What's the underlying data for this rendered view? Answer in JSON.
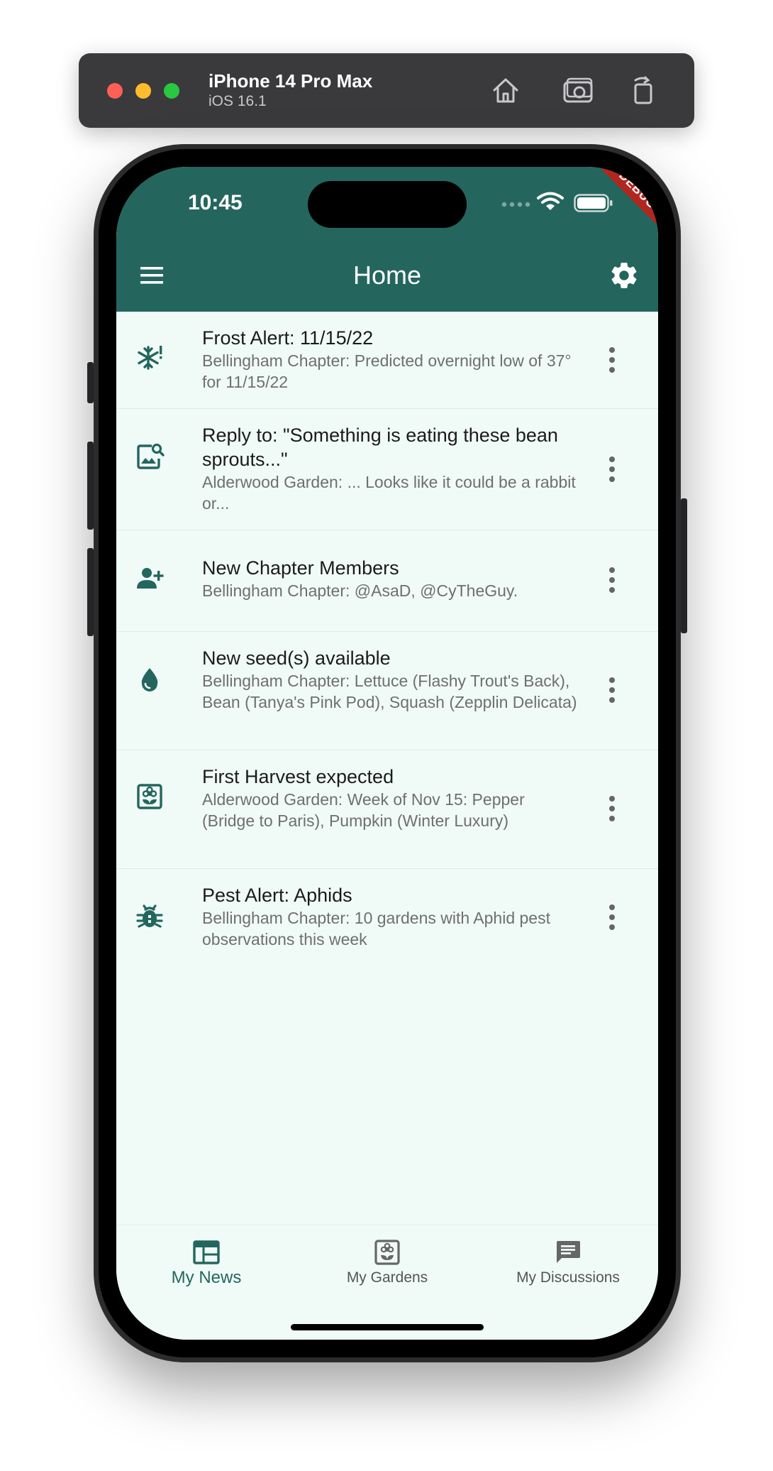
{
  "simulator": {
    "device_name": "iPhone 14 Pro Max",
    "os_version": "iOS 16.1",
    "icons": [
      "home-icon",
      "screenshot-icon",
      "rotate-icon"
    ]
  },
  "status_bar": {
    "time": "10:45"
  },
  "debug_banner": "DEBUG",
  "header": {
    "title": "Home",
    "menu_icon": "menu-icon",
    "settings_icon": "gear-icon"
  },
  "news": [
    {
      "icon": "snowflake-alert-icon",
      "title": "Frost Alert: 11/15/22",
      "subtitle": "Bellingham Chapter: Predicted overnight low of 37° for 11/15/22"
    },
    {
      "icon": "image-search-icon",
      "title": "Reply to: \"Something is eating these bean sprouts...\"",
      "subtitle": "Alderwood Garden: ... Looks like it could be a rabbit or..."
    },
    {
      "icon": "person-add-icon",
      "title": "New Chapter Members",
      "subtitle": "Bellingham Chapter: @AsaD, @CyTheGuy."
    },
    {
      "icon": "water-drop-icon",
      "title": "New seed(s) available",
      "subtitle": "Bellingham Chapter: Lettuce (Flashy Trout's Back), Bean (Tanya's Pink Pod), Squash (Zepplin Delicata)"
    },
    {
      "icon": "local-florist-icon",
      "title": "First Harvest expected",
      "subtitle": "Alderwood Garden: Week of Nov 15: Pepper (Bridge to Paris), Pumpkin (Winter Luxury)"
    },
    {
      "icon": "bug-icon",
      "title": "Pest Alert: Aphids",
      "subtitle": "Bellingham Chapter: 10 gardens with Aphid pest observations this week"
    }
  ],
  "bottom_nav": [
    {
      "label": "My News",
      "icon": "newspaper-icon",
      "active": true
    },
    {
      "label": "My Gardens",
      "icon": "garden-icon",
      "active": false
    },
    {
      "label": "My Discussions",
      "icon": "chat-icon",
      "active": false
    }
  ],
  "colors": {
    "primary": "#24665e",
    "background": "#f0fbf8",
    "icon": "#24665e"
  }
}
